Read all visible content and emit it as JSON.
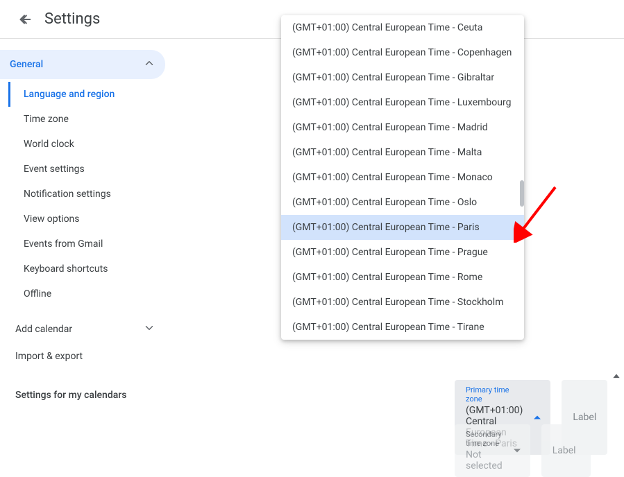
{
  "header": {
    "title": "Settings"
  },
  "sidebar": {
    "section_label": "General",
    "items": [
      {
        "label": "Language and region"
      },
      {
        "label": "Time zone"
      },
      {
        "label": "World clock"
      },
      {
        "label": "Event settings"
      },
      {
        "label": "Notification settings"
      },
      {
        "label": "View options"
      },
      {
        "label": "Events from Gmail"
      },
      {
        "label": "Keyboard shortcuts"
      },
      {
        "label": "Offline"
      }
    ],
    "footer": [
      {
        "label": "Add calendar"
      },
      {
        "label": "Import & export"
      }
    ],
    "section_title_2": "Settings for my calendars"
  },
  "timezone_dropdown": {
    "options": [
      "(GMT+01:00) Central European Time - Ceuta",
      "(GMT+01:00) Central European Time - Copenhagen",
      "(GMT+01:00) Central European Time - Gibraltar",
      "(GMT+01:00) Central European Time - Luxembourg",
      "(GMT+01:00) Central European Time - Madrid",
      "(GMT+01:00) Central European Time - Malta",
      "(GMT+01:00) Central European Time - Monaco",
      "(GMT+01:00) Central European Time - Oslo",
      "(GMT+01:00) Central European Time - Paris",
      "(GMT+01:00) Central European Time - Prague",
      "(GMT+01:00) Central European Time - Rome",
      "(GMT+01:00) Central European Time - Stockholm",
      "(GMT+01:00) Central European Time - Tirane"
    ],
    "selected_index": 8
  },
  "primary": {
    "label": "Primary time zone",
    "value": "(GMT+01:00) Central European Time - Paris",
    "input_label_placeholder": "Label"
  },
  "secondary": {
    "label": "Secondary time zone",
    "value": "Not selected",
    "input_label_placeholder": "Label"
  }
}
